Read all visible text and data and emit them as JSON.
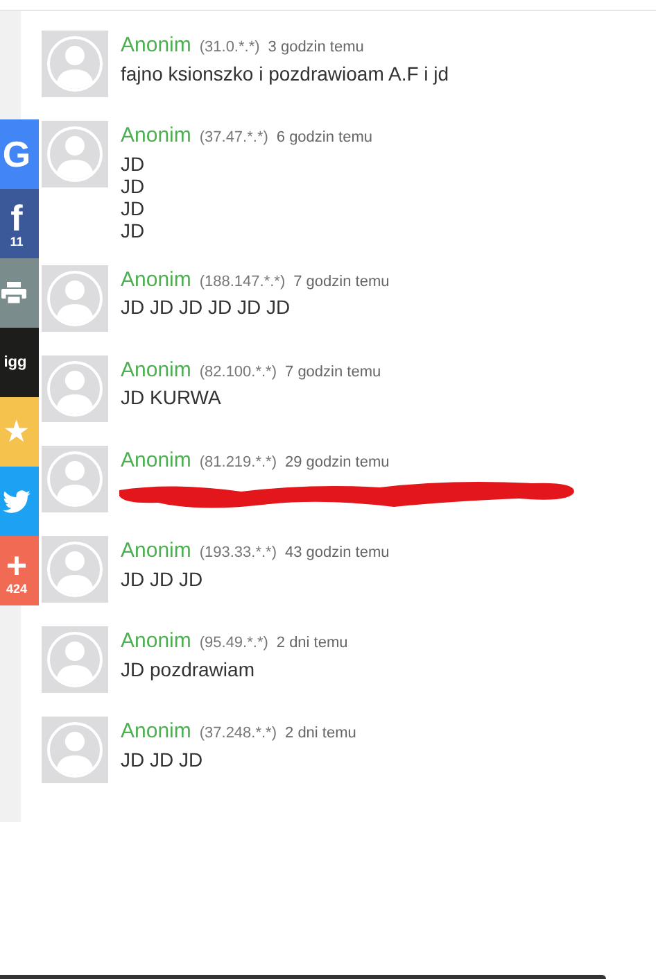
{
  "share_bar": [
    {
      "kind": "google",
      "glyph": "G"
    },
    {
      "kind": "facebook",
      "glyph": "f",
      "count": "11"
    },
    {
      "kind": "print"
    },
    {
      "kind": "digg",
      "glyph": "igg"
    },
    {
      "kind": "favorite",
      "glyph": "★"
    },
    {
      "kind": "twitter"
    },
    {
      "kind": "more",
      "glyph": "+",
      "count": "424"
    }
  ],
  "comments": [
    {
      "author": "Anonim",
      "ip": "(31.0.*.*)",
      "time": "3 godzin temu",
      "lines": [
        "fajno ksionszko i pozdrawioam A.F i jd"
      ]
    },
    {
      "author": "Anonim",
      "ip": "(37.47.*.*)",
      "time": "6 godzin temu",
      "lines": [
        "JD",
        "JD",
        "JD",
        "JD"
      ]
    },
    {
      "author": "Anonim",
      "ip": "(188.147.*.*)",
      "time": "7 godzin temu",
      "lines": [
        "JD JD JD JD JD JD"
      ]
    },
    {
      "author": "Anonim",
      "ip": "(82.100.*.*)",
      "time": "7 godzin temu",
      "lines": [
        "JD KURWA"
      ]
    },
    {
      "author": "Anonim",
      "ip": "(81.219.*.*)",
      "time": "29 godzin temu",
      "redacted": true
    },
    {
      "author": "Anonim",
      "ip": "(193.33.*.*)",
      "time": "43 godzin temu",
      "lines": [
        "JD JD JD"
      ]
    },
    {
      "author": "Anonim",
      "ip": "(95.49.*.*)",
      "time": "2 dni temu",
      "lines": [
        "JD pozdrawiam"
      ]
    },
    {
      "author": "Anonim",
      "ip": "(37.248.*.*)",
      "time": "2 dni temu",
      "lines": [
        "JD JD JD"
      ]
    }
  ]
}
